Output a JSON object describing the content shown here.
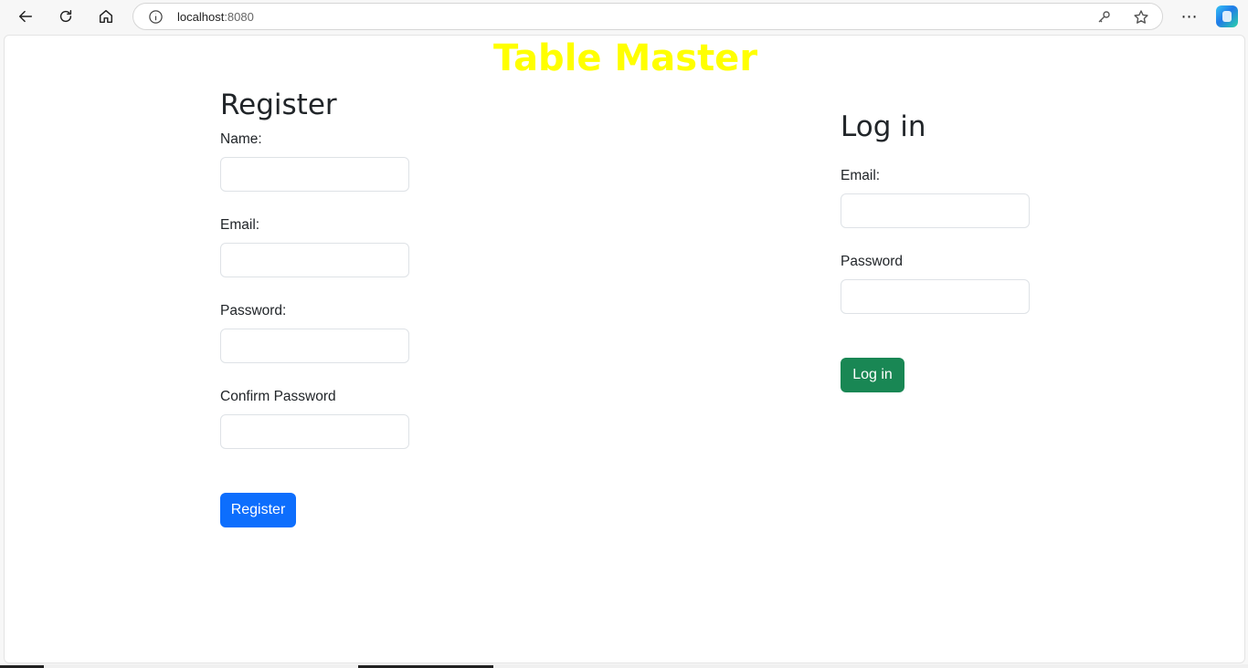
{
  "browser": {
    "url_host": "localhost",
    "url_port": ":8080"
  },
  "page": {
    "title": "Table Master",
    "title_color": "#ffff00"
  },
  "register": {
    "heading": "Register",
    "name_label": "Name:",
    "email_label": "Email:",
    "password_label": "Password:",
    "confirm_label": "Confirm Password",
    "button": "Register",
    "button_color": "#0d6efd"
  },
  "login": {
    "heading": "Log in",
    "email_label": "Email:",
    "password_label": "Password",
    "button": "Log in",
    "button_color": "#198754"
  }
}
